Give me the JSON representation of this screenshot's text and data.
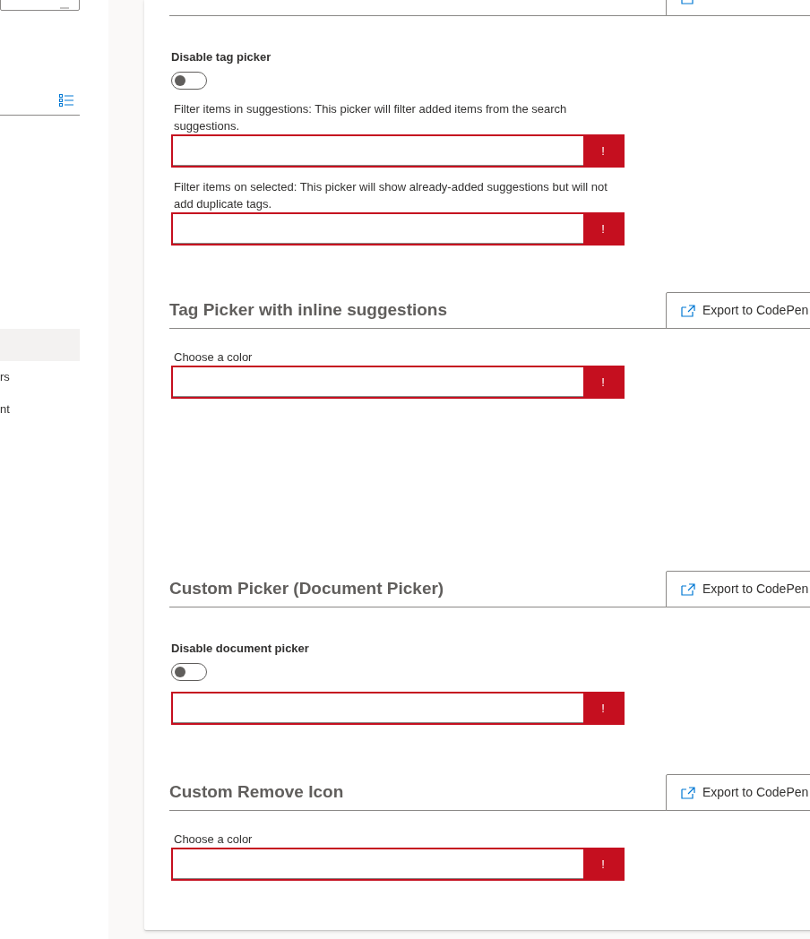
{
  "sidebar": {
    "items": [
      {
        "selected": true
      },
      {
        "label": "rs",
        "selected": false
      },
      {
        "label": "nt",
        "selected": false
      }
    ]
  },
  "sections": [
    {
      "controls": [
        {
          "kind": "toggle",
          "label": "Disable tag picker",
          "on": false
        },
        {
          "kind": "picker",
          "label": "Filter items in suggestions: This picker will filter added items from the search suggestions.",
          "error": true,
          "error_mark": "!"
        },
        {
          "kind": "picker",
          "label": "Filter items on selected: This picker will show already-added suggestions but will not add duplicate tags.",
          "error": true,
          "error_mark": "!"
        }
      ]
    },
    {
      "title": "Tag Picker with inline suggestions",
      "export_button": "Export to CodePen",
      "controls": [
        {
          "kind": "picker",
          "label": "Choose a color",
          "error": true,
          "error_mark": "!"
        }
      ]
    },
    {
      "title": "Custom Picker (Document Picker)",
      "export_button": "Export to CodePen",
      "controls": [
        {
          "kind": "toggle",
          "label": "Disable document picker",
          "on": false
        },
        {
          "kind": "picker",
          "error": true,
          "error_mark": "!"
        }
      ]
    },
    {
      "title": "Custom Remove Icon",
      "export_button": "Export to CodePen",
      "controls": [
        {
          "kind": "picker",
          "label": "Choose a color",
          "error": true,
          "error_mark": "!"
        }
      ]
    }
  ]
}
